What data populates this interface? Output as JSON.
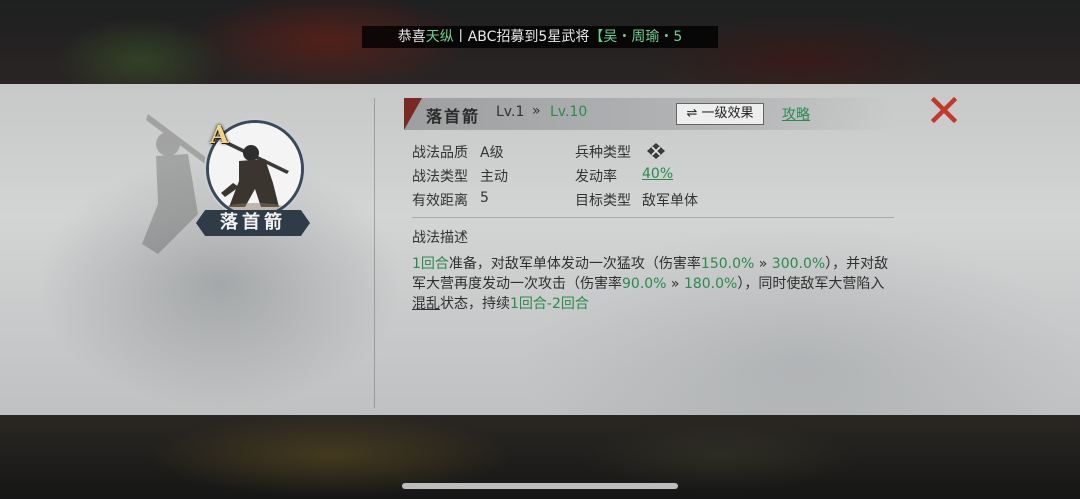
{
  "announcement": {
    "prefix": "恭喜",
    "server": "天纵",
    "player": "丨ABC",
    "middle": "招募到5星武将",
    "general": "【吴・周瑜・5"
  },
  "skill": {
    "grade": "A",
    "name": "落首箭",
    "title": "落首箭",
    "level_current": "Lv.1",
    "level_arrow": "»",
    "level_max": "Lv.10",
    "effect_button": "⇌ 一级效果",
    "strategy_link": "攻略"
  },
  "attributes": {
    "quality_label": "战法品质",
    "quality_value": "A级",
    "troop_label": "兵种类型",
    "type_label": "战法类型",
    "type_value": "主动",
    "rate_label": "发动率",
    "rate_value": "40%",
    "range_label": "有效距离",
    "range_value": "5",
    "target_label": "目标类型",
    "target_value": "敌军单体"
  },
  "description": {
    "label": "战法描述",
    "p1": "1回合",
    "p2": "准备，对敌军单体发动一次猛攻（伤害率",
    "p3": "150.0%",
    "p4": " » ",
    "p5": "300.0%",
    "p6": "），并对敌军大营再度发动一次攻击（伤害率",
    "p7": "90.0%",
    "p8": " » ",
    "p9": "180.0%",
    "p10": "），同时使敌军大营陷入",
    "p11": "混乱",
    "p12": "状态，持续",
    "p13": "1回合-2回合"
  },
  "colors": {
    "accent_green": "#2c8a4d",
    "close_red": "#c0392b",
    "plate_blue": "#2f3b47"
  },
  "icons": {
    "close": "close-x-icon",
    "troop": "crossed-swords-icon"
  }
}
